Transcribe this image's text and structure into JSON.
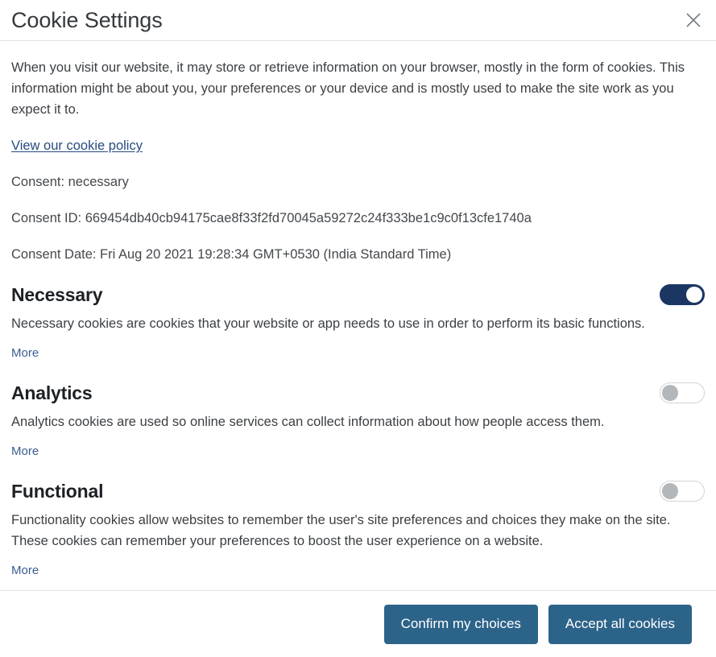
{
  "dialog": {
    "title": "Cookie Settings",
    "close_icon": "close-icon",
    "intro": "When you visit our website, it may store or retrieve information on your browser, mostly in the form of cookies. This information might be about you, your preferences or your device and is mostly used to make the site work as you expect it to.",
    "policy_link": "View our cookie policy",
    "consent_status": "Consent: necessary",
    "consent_id": "Consent ID: 669454db40cb94175cae8f33f2fd70045a59272c24f333be1c9c0f13cfe1740a",
    "consent_date": "Consent Date: Fri Aug 20 2021 19:28:34 GMT+0530 (India Standard Time)"
  },
  "categories": [
    {
      "title": "Necessary",
      "description": "Necessary cookies are cookies that your website or app needs to use in order to perform its basic functions.",
      "more_label": "More",
      "enabled": true
    },
    {
      "title": "Analytics",
      "description": "Analytics cookies are used so online services can collect information about how people access them.",
      "more_label": "More",
      "enabled": false
    },
    {
      "title": "Functional",
      "description": "Functionality cookies allow websites to remember the user's site preferences and choices they make on the site. These cookies can remember your preferences to boost the user experience on a website.",
      "more_label": "More",
      "enabled": false
    }
  ],
  "footer": {
    "confirm_label": "Confirm my choices",
    "accept_all_label": "Accept all cookies"
  },
  "colors": {
    "toggle_on": "#1c3664",
    "button": "#2c6389",
    "link": "#274b82",
    "more_link": "#3a5d91"
  }
}
